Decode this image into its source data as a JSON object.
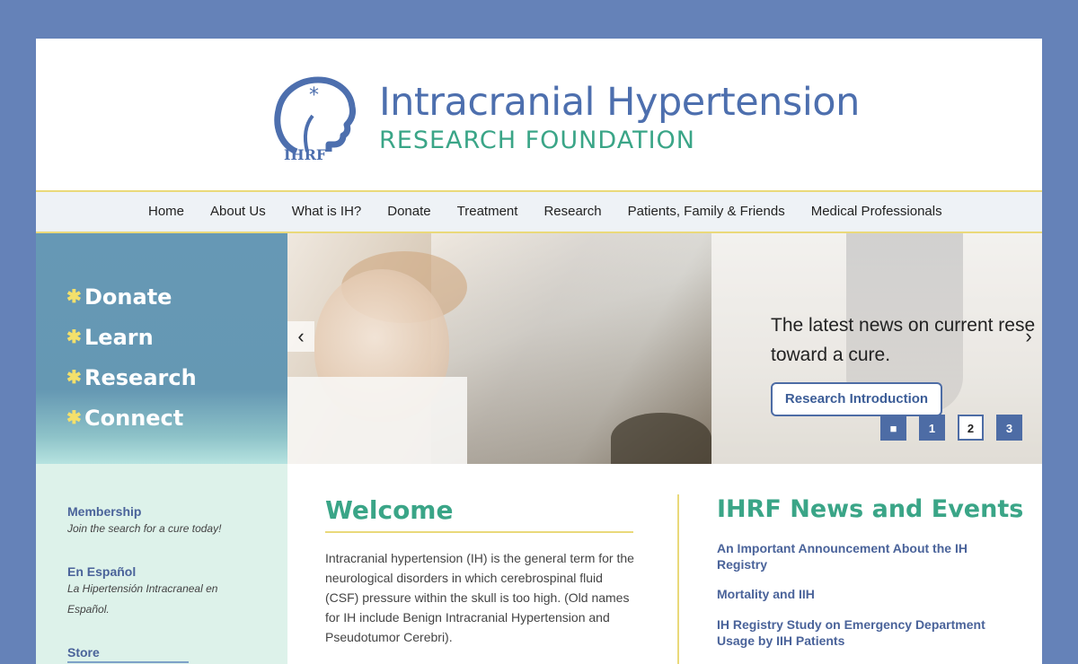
{
  "brand": {
    "logo_text": "IHRF",
    "title": "Intracranial Hypertension",
    "subtitle": "RESEARCH FOUNDATION"
  },
  "nav": {
    "items": [
      "Home",
      "About Us",
      "What is IH?",
      "Donate",
      "Treatment",
      "Research",
      "Patients, Family & Friends",
      "Medical Professionals"
    ]
  },
  "cta": {
    "items": [
      {
        "star": "✱",
        "label": "Donate"
      },
      {
        "star": "✱",
        "label": "Learn"
      },
      {
        "star": "✱",
        "label": "Research"
      },
      {
        "star": "✱",
        "label": "Connect"
      }
    ]
  },
  "sidebar": {
    "membership": {
      "title": "Membership",
      "desc": "Join the search for a cure today!"
    },
    "espanol": {
      "title": "En Español",
      "desc_line1": "La Hipertensión Intracraneal en",
      "desc_line2": "Español."
    },
    "store": {
      "title": "Store"
    }
  },
  "slider": {
    "text_line1": "The latest news on current rese",
    "text_line2": "toward a cure.",
    "button_label": "Research Introduction",
    "prev_icon": "‹",
    "next_icon": "›",
    "dots": [
      "■",
      "1",
      "2",
      "3"
    ],
    "active_dot": "2"
  },
  "welcome": {
    "title": "Welcome",
    "text": "Intracranial hypertension (IH) is the general term for the neurological disorders in which cerebrospinal fluid (CSF) pressure within the skull is too high. (Old names for IH include Benign Intracranial Hypertension and Pseudotumor Cerebri)."
  },
  "news": {
    "title": "IHRF News and Events",
    "items": [
      "An Important Announcement About the IH Registry",
      "Mortality and IIH",
      "IH Registry Study on Emergency Department Usage by IIH Patients"
    ]
  },
  "colors": {
    "background": "#6582b8",
    "brand_blue": "#4d6fae",
    "brand_green": "#3aa587",
    "accent_yellow": "#ead97a",
    "link_blue": "#4a639a"
  }
}
